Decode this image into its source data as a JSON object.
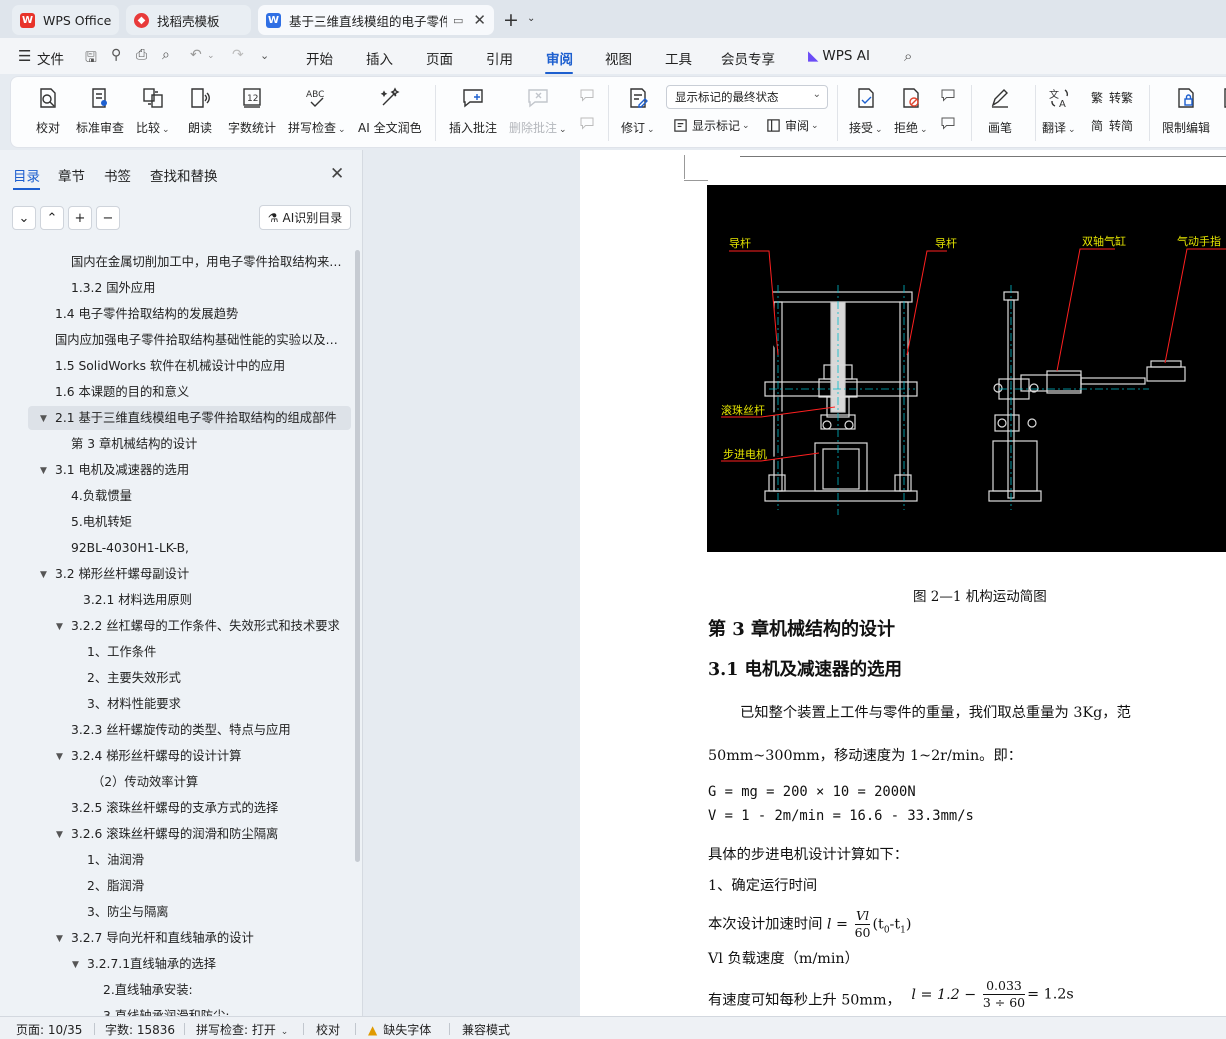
{
  "tabs": [
    {
      "label": "WPS Office"
    },
    {
      "label": "找稻壳模板"
    },
    {
      "label": "基于三维直线模组的电子零件"
    }
  ],
  "menu": {
    "file": "文件",
    "items": [
      "开始",
      "插入",
      "页面",
      "引用",
      "审阅",
      "视图",
      "工具",
      "会员专享",
      "WPS AI"
    ],
    "active": "审阅"
  },
  "ribbon": {
    "proofread": "校对",
    "standard_review": "标准审查",
    "compare": "比较",
    "read_aloud": "朗读",
    "word_count": "字数统计",
    "spell_check": "拼写检查",
    "ai_proofread": "AI 全文润色",
    "insert_comment": "插入批注",
    "delete_comment": "删除批注",
    "track_changes": "修订",
    "markup_mode": "显示标记的最终状态",
    "show_markup": "显示标记",
    "review_pane": "审阅",
    "accept": "接受",
    "reject": "拒绝",
    "pen": "画笔",
    "translate": "翻译",
    "to_traditional": "转繁",
    "to_simplified": "转简",
    "restrict_editing": "限制编辑",
    "cut_off_next": "文"
  },
  "nav": {
    "tabs": [
      "目录",
      "章节",
      "书签",
      "查找和替换"
    ],
    "ai_toc_label": "AI识别目录",
    "toc": [
      {
        "text": "国内在金属切削加工中，用电子零件拾取结构来实现的...",
        "level": 3,
        "toggle": ""
      },
      {
        "text": "1.3.2  国外应用",
        "level": 3,
        "toggle": ""
      },
      {
        "text": "1.4 电子零件拾取结构的发展趋势",
        "level": 2,
        "toggle": ""
      },
      {
        "text": "国内应加强电子零件拾取结构基础性能的实验以及基础...",
        "level": 2,
        "toggle": ""
      },
      {
        "text": "1.5 SolidWorks 软件在机械设计中的应用",
        "level": 2,
        "toggle": ""
      },
      {
        "text": "1.6 本课题的目的和意义",
        "level": 2,
        "toggle": ""
      },
      {
        "text": "2.1 基于三维直线模组电子零件拾取结构的组成部件",
        "level": 2,
        "toggle": "▼"
      },
      {
        "text": "第 3 章机械结构的设计",
        "level": 3,
        "toggle": ""
      },
      {
        "text": "3.1 电机及减速器的选用",
        "level": 2,
        "toggle": "▼"
      },
      {
        "text": "4.负载惯量",
        "level": 3,
        "toggle": ""
      },
      {
        "text": "5.电机转矩",
        "level": 3,
        "toggle": ""
      },
      {
        "text": "92BL-4030H1-LK-B,",
        "level": 3,
        "toggle": ""
      },
      {
        "text": "3.2 梯形丝杆螺母副设计",
        "level": 2,
        "toggle": "▼"
      },
      {
        "text": "3.2.1 材料选用原则",
        "level": 4,
        "toggle": ""
      },
      {
        "text": "3.2.2 丝杠螺母的工作条件、失效形式和技术要求",
        "level": 3,
        "toggle": "▼"
      },
      {
        "text": "1、工作条件",
        "level": 4,
        "toggle": ""
      },
      {
        "text": "2、主要失效形式",
        "level": 4,
        "toggle": ""
      },
      {
        "text": "3、材料性能要求",
        "level": 4,
        "toggle": ""
      },
      {
        "text": "3.2.3 丝杆螺旋传动的类型、特点与应用",
        "level": 3,
        "toggle": ""
      },
      {
        "text": "3.2.4 梯形丝杆螺母的设计计算",
        "level": 3,
        "toggle": "▼"
      },
      {
        "text": "（2）传动效率计算",
        "level": 5,
        "toggle": ""
      },
      {
        "text": "3.2.5 滚珠丝杆螺母的支承方式的选择",
        "level": 3,
        "toggle": ""
      },
      {
        "text": "3.2.6 滚珠丝杆螺母的润滑和防尘隔离",
        "level": 3,
        "toggle": "▼"
      },
      {
        "text": "1、油润滑",
        "level": 4,
        "toggle": ""
      },
      {
        "text": "2、脂润滑",
        "level": 4,
        "toggle": ""
      },
      {
        "text": "3、防尘与隔离",
        "level": 4,
        "toggle": ""
      },
      {
        "text": "3.2.7 导向光杆和直线轴承的设计",
        "level": 3,
        "toggle": "▼"
      },
      {
        "text": "3.2.7.1直线轴承的选择",
        "level": 4,
        "toggle": "▼"
      },
      {
        "text": "2.直线轴承安装:",
        "level": 5,
        "toggle": ""
      },
      {
        "text": "3.直线轴承润滑和防尘:",
        "level": 5,
        "toggle": ""
      }
    ]
  },
  "doc": {
    "cad_labels": [
      "导杆",
      "导杆",
      "双轴气缸",
      "气动手指",
      "滚珠丝杆",
      "步进电机"
    ],
    "figure_caption": "图 2—1   机构运动简图",
    "chapter_title": "第 3 章机械结构的设计",
    "section_title": "3.1 电机及减速器的选用",
    "para1": "已知整个装置上工件与零件的重量，我们取总重量为 3Kg，范",
    "para2": "50mm~300mm，移动速度为 1~2r/min。即：",
    "formula1": "G = mg = 200 × 10 = 2000N",
    "formula2": "V = 1 - 2m/min = 16.6 - 33.3mm/s",
    "para3": "具体的步进电机设计计算如下：",
    "para4": "1、确定运行时间",
    "para5_prefix": "本次设计加速时间",
    "frac1_lhs": "l =",
    "frac1_num": "Vl",
    "frac1_den": "60",
    "frac1_tail": "(t",
    "frac1_sub0": "0",
    "frac1_mid": "-t",
    "frac1_sub1": "1",
    "frac1_close": ")",
    "para6": "Vl 负载速度（m/min）",
    "para7": "有速度可知每秒上升 50mm，",
    "frac2_lhs": "l = 1.2 −",
    "frac2_num": "0.033",
    "frac2_den": "3 ÷ 60",
    "frac2_rhs": "= 1.2s"
  },
  "status": {
    "page": "页面: 10/35",
    "words": "字数: 15836",
    "spell": "拼写检查: 打开",
    "proof": "校对",
    "missing_font": "缺失字体",
    "compat": "兼容模式"
  },
  "colors": {
    "accent": "#1d5fcf",
    "cad_bg": "#000000",
    "cad_label": "#e6e600",
    "cad_leader": "#ff2020"
  }
}
